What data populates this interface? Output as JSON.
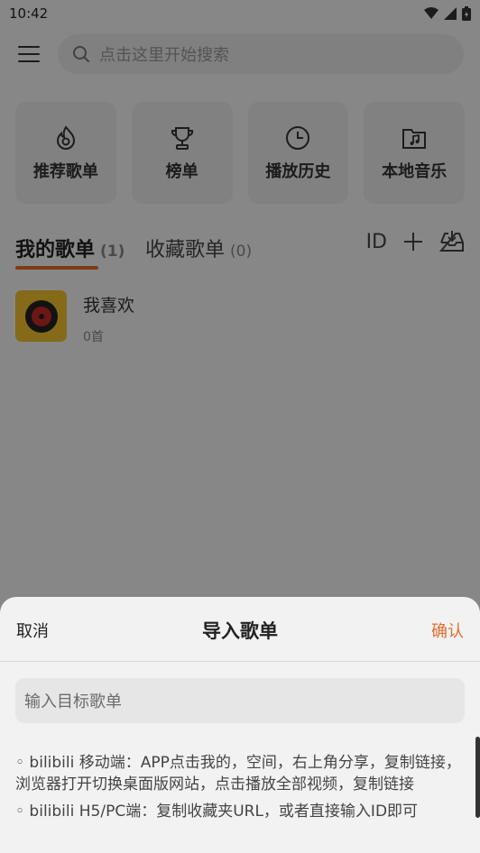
{
  "status_bar": {
    "time": "10:42"
  },
  "search": {
    "placeholder": "点击这里开始搜索"
  },
  "quick_links": [
    {
      "label": "推荐歌单",
      "icon": "flame-icon"
    },
    {
      "label": "榜单",
      "icon": "trophy-icon"
    },
    {
      "label": "播放历史",
      "icon": "clock-icon"
    },
    {
      "label": "本地音乐",
      "icon": "music-folder-icon"
    }
  ],
  "tabs": {
    "my_label": "我的歌单",
    "my_count": "(1)",
    "fav_label": "收藏歌单",
    "fav_count": "(0)",
    "id_label": "ID"
  },
  "playlist": {
    "name": "我喜欢",
    "count": "0首"
  },
  "sheet": {
    "cancel": "取消",
    "title": "导入歌单",
    "confirm": "确认",
    "input_placeholder": "输入目标歌单",
    "notes": [
      "◦ bilibili 移动端：APP点击我的，空间，右上角分享，复制链接，浏览器打开切换桌面版网站，点击播放全部视频，复制链接",
      "◦ bilibili H5/PC端：复制收藏夹URL，或者直接输入ID即可"
    ]
  },
  "colors": {
    "accent": "#e36d2b",
    "background": "#f6f6f6"
  }
}
